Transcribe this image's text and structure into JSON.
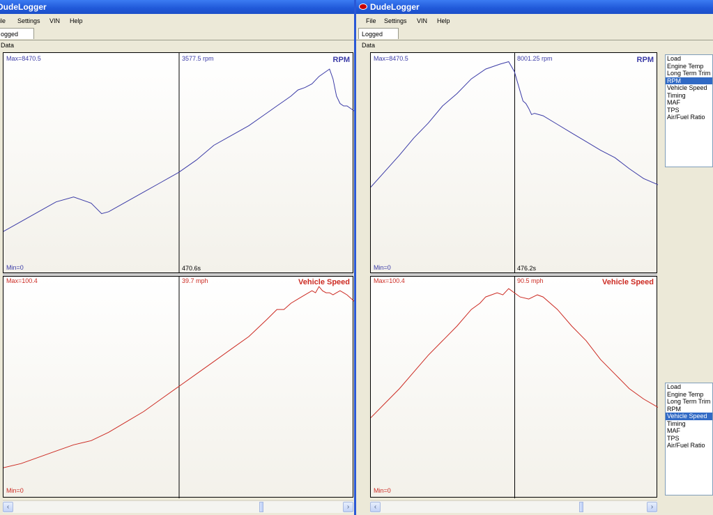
{
  "app": {
    "title": "DudeLogger"
  },
  "menu": [
    "File",
    "Settings",
    "VIN",
    "Help"
  ],
  "tab_label": "Logged Data",
  "colors": {
    "rpm": "#3a3aa6",
    "speed": "#cc2a22",
    "cursor": "#000000"
  },
  "windows": [
    {
      "title_visible": "DudeLogger",
      "menu_visible": [
        "ile",
        "Settings",
        "VIN",
        "Help"
      ],
      "tab_visible": "ogged Data",
      "cursor_time": "470.6s",
      "rpm_panel": {
        "name": "RPM",
        "max": "Max=8470.5",
        "min": "Min=0",
        "cursor_value": "3577.5 rpm"
      },
      "speed_panel": {
        "name": "Vehicle Speed",
        "max": "Max=100.4",
        "min": "Min=0",
        "cursor_value": "39.7 mph"
      }
    },
    {
      "title_visible": "DudeLogger",
      "menu_visible": [
        "File",
        "Settings",
        "VIN",
        "Help"
      ],
      "tab_visible": "Logged Data",
      "cursor_time": "476.2s",
      "rpm_panel": {
        "name": "RPM",
        "max": "Max=8470.5",
        "min": "Min=0",
        "cursor_value": "8001.25 rpm"
      },
      "speed_panel": {
        "name": "Vehicle Speed",
        "max": "Max=100.4",
        "min": "Min=0",
        "cursor_value": "90.5 mph"
      }
    }
  ],
  "channel_lists": [
    {
      "items": [
        "Load",
        "Engine Temp",
        "Long Term Trim",
        "RPM",
        "Vehicle Speed",
        "Timing",
        "MAF",
        "TPS",
        "Air/Fuel Ratio"
      ],
      "selected": "RPM"
    },
    {
      "items": [
        "Load",
        "Engine Temp",
        "Long Term Trim",
        "RPM",
        "Vehicle Speed",
        "Timing",
        "MAF",
        "TPS",
        "Air/Fuel Ratio"
      ],
      "selected": "Vehicle Speed"
    }
  ],
  "scroll_icons": {
    "left": "scroll-left-arrow-icon",
    "right": "scroll-right-arrow-icon",
    "glyph_left": "‹",
    "glyph_right": "›"
  },
  "chart_data": [
    {
      "type": "line",
      "title": "RPM",
      "ylim": [
        0,
        8470.5
      ],
      "cursor": {
        "time": "470.6s",
        "value": 3577.5
      },
      "series": [
        {
          "name": "RPM",
          "x": [
            0,
            5,
            10,
            15,
            20,
            25,
            28,
            30,
            35,
            40,
            45,
            50,
            55,
            60,
            65,
            70,
            75,
            78,
            80,
            82,
            84,
            86,
            88,
            90,
            92,
            93,
            94,
            95,
            96,
            97,
            98,
            100
          ],
          "y": [
            1500,
            1900,
            2300,
            2700,
            2900,
            2650,
            2220,
            2300,
            2700,
            3100,
            3500,
            3900,
            4400,
            5000,
            5400,
            5800,
            6300,
            6600,
            6800,
            7000,
            7250,
            7350,
            7500,
            7800,
            8000,
            8100,
            7700,
            7000,
            6700,
            6600,
            6600,
            6400
          ]
        }
      ]
    },
    {
      "type": "line",
      "title": "Vehicle Speed",
      "ylim": [
        0,
        100.4
      ],
      "cursor": {
        "time": "470.6s",
        "value": 39.7
      },
      "series": [
        {
          "name": "Vehicle Speed",
          "x": [
            0,
            5,
            10,
            15,
            20,
            25,
            30,
            35,
            40,
            45,
            50,
            55,
            60,
            65,
            70,
            75,
            78,
            80,
            82,
            84,
            86,
            88,
            89,
            90,
            91,
            92,
            93,
            94,
            95,
            96,
            97,
            98,
            100
          ],
          "y": [
            12,
            14,
            17,
            20,
            23,
            25,
            29,
            34,
            39,
            45,
            51,
            57,
            63,
            69,
            75,
            83,
            88,
            88,
            91,
            93,
            95,
            97,
            96,
            99,
            97,
            96,
            96,
            95,
            96,
            97,
            96,
            95,
            92
          ]
        }
      ]
    },
    {
      "type": "line",
      "title": "RPM",
      "ylim": [
        0,
        8470.5
      ],
      "cursor": {
        "time": "476.2s",
        "value": 8001.25
      },
      "series": [
        {
          "name": "RPM",
          "x": [
            0,
            5,
            10,
            15,
            20,
            25,
            30,
            35,
            40,
            45,
            48,
            50,
            51,
            52,
            53,
            54,
            55,
            56,
            57,
            60,
            65,
            70,
            75,
            80,
            85,
            90,
            95,
            100
          ],
          "y": [
            3300,
            3950,
            4600,
            5300,
            5900,
            6600,
            7100,
            7700,
            8100,
            8300,
            8400,
            8000,
            7600,
            7200,
            6800,
            6700,
            6500,
            6250,
            6300,
            6200,
            5850,
            5500,
            5150,
            4800,
            4500,
            4050,
            3650,
            3400
          ]
        }
      ]
    },
    {
      "type": "line",
      "title": "Vehicle Speed",
      "ylim": [
        0,
        100.4
      ],
      "cursor": {
        "time": "476.2s",
        "value": 90.5
      },
      "series": [
        {
          "name": "Vehicle Speed",
          "x": [
            0,
            5,
            10,
            15,
            20,
            25,
            30,
            35,
            38,
            40,
            44,
            46,
            48,
            50,
            52,
            55,
            58,
            60,
            65,
            70,
            75,
            80,
            85,
            90,
            95,
            100
          ],
          "y": [
            36,
            43,
            50,
            58,
            66,
            73,
            80,
            88,
            91,
            94,
            96,
            95,
            98,
            96,
            94,
            93,
            95,
            94,
            88,
            80,
            73,
            64,
            57,
            50,
            45,
            41
          ]
        }
      ]
    }
  ]
}
